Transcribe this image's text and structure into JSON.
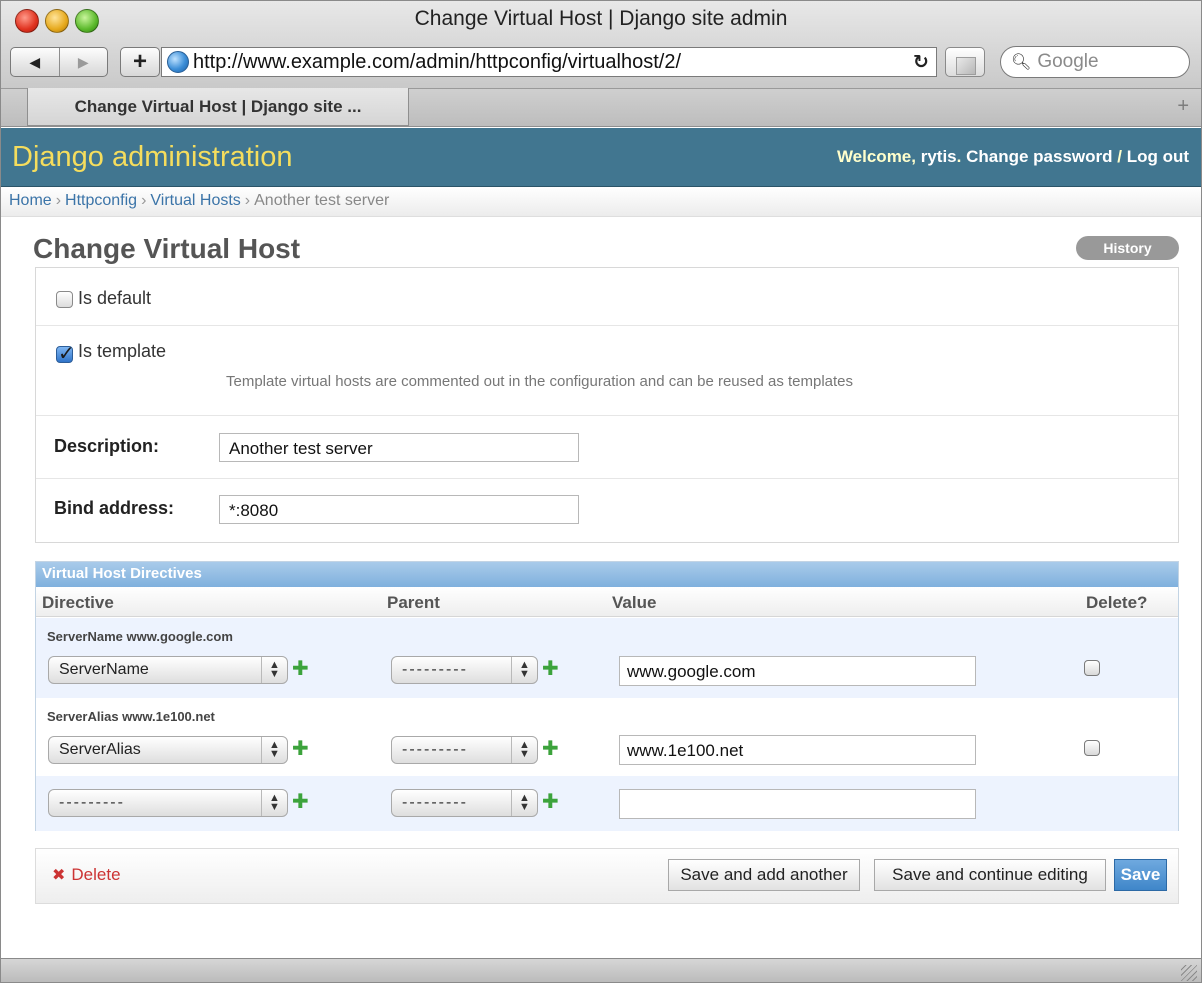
{
  "browser": {
    "window_title": "Change Virtual Host | Django site admin",
    "url": "http://www.example.com/admin/httpconfig/virtualhost/2/",
    "search_placeholder": "Google",
    "tab_label": "Change Virtual Host | Django site ..."
  },
  "admin": {
    "branding": "Django administration",
    "welcome": "Welcome, ",
    "username": "rytis",
    "change_password": "Change password",
    "log_out": "Log out"
  },
  "breadcrumbs": [
    "Home",
    "Httpconfig",
    "Virtual Hosts",
    "Another test server"
  ],
  "page": {
    "title": "Change Virtual Host",
    "history": "History"
  },
  "form": {
    "is_default": {
      "label": "Is default",
      "checked": false
    },
    "is_template": {
      "label": "Is template",
      "checked": true,
      "help": "Template virtual hosts are commented out in the configuration and can be reused as templates"
    },
    "description": {
      "label": "Description:",
      "value": "Another test server"
    },
    "bind_address": {
      "label": "Bind address:",
      "value": "*:8080"
    }
  },
  "inline": {
    "caption": "Virtual Host Directives",
    "headers": {
      "directive": "Directive",
      "parent": "Parent",
      "value": "Value",
      "delete": "Delete?"
    },
    "rows": [
      {
        "original": "ServerName www.google.com",
        "directive": "ServerName",
        "parent": "---------",
        "value": "www.google.com"
      },
      {
        "original": "ServerAlias www.1e100.net",
        "directive": "ServerAlias",
        "parent": "---------",
        "value": "www.1e100.net"
      },
      {
        "original": "",
        "directive": "---------",
        "parent": "---------",
        "value": ""
      }
    ]
  },
  "actions": {
    "delete": "Delete",
    "save_add_another": "Save and add another",
    "save_continue": "Save and continue editing",
    "save": "Save"
  },
  "colors": {
    "header_bg": "#417690",
    "branding": "#f5dd5d",
    "link": "#3b74a8",
    "inline_caption": "#7fb0dd",
    "save_button": "#3f86c9",
    "delete_link": "#cc3333"
  }
}
